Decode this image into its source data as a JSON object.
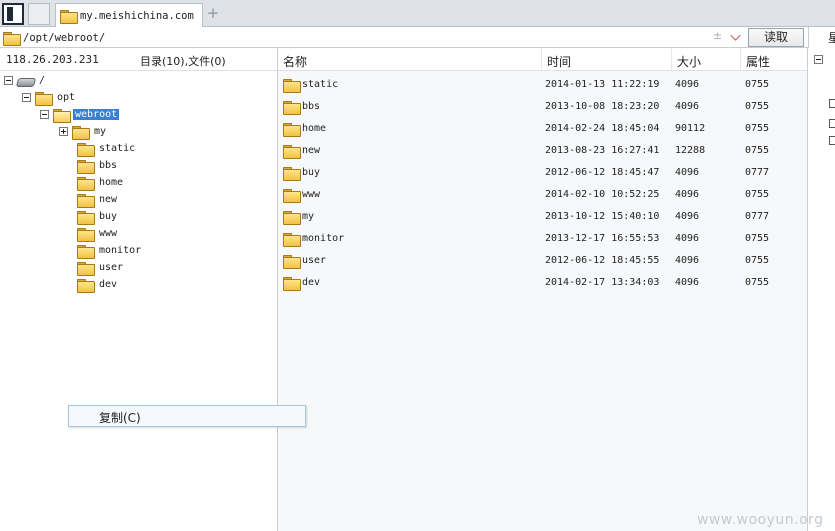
{
  "tabbar": {
    "active_tab_label": "my.meishichina.com",
    "new_tab_label": "+"
  },
  "address": {
    "path": "/opt/webroot/",
    "extra_plus": "±",
    "read_label": "读取",
    "right_label": "星"
  },
  "left": {
    "ip": "118.26.203.231",
    "summary": "目录(10),文件(0)",
    "tree": [
      {
        "label": "/",
        "kind": "drive",
        "expander": "minus",
        "depth": 0
      },
      {
        "label": "opt",
        "kind": "folder",
        "expander": "minus",
        "depth": 1
      },
      {
        "label": "webroot",
        "kind": "folder-open",
        "expander": "minus",
        "depth": 2,
        "selected": true
      },
      {
        "label": "my",
        "kind": "folder",
        "expander": "plus",
        "depth": 3
      },
      {
        "label": "static",
        "kind": "folder",
        "expander": "",
        "depth": 3
      },
      {
        "label": "bbs",
        "kind": "folder",
        "expander": "",
        "depth": 3
      },
      {
        "label": "home",
        "kind": "folder",
        "expander": "",
        "depth": 3
      },
      {
        "label": "new",
        "kind": "folder",
        "expander": "",
        "depth": 3
      },
      {
        "label": "buy",
        "kind": "folder",
        "expander": "",
        "depth": 3
      },
      {
        "label": "www",
        "kind": "folder",
        "expander": "",
        "depth": 3
      },
      {
        "label": "monitor",
        "kind": "folder",
        "expander": "",
        "depth": 3
      },
      {
        "label": "user",
        "kind": "folder",
        "expander": "",
        "depth": 3
      },
      {
        "label": "dev",
        "kind": "folder",
        "expander": "",
        "depth": 3
      }
    ]
  },
  "context_menu": {
    "item_label": "复制(C)"
  },
  "files": {
    "columns": [
      "名称",
      "时间",
      "大小",
      "属性"
    ],
    "rows": [
      {
        "name": "static",
        "time": "2014-01-13 11:22:19",
        "size": "4096",
        "attr": "0755"
      },
      {
        "name": "bbs",
        "time": "2013-10-08 18:23:20",
        "size": "4096",
        "attr": "0755"
      },
      {
        "name": "home",
        "time": "2014-02-24 18:45:04",
        "size": "90112",
        "attr": "0755"
      },
      {
        "name": "new",
        "time": "2013-08-23 16:27:41",
        "size": "12288",
        "attr": "0755"
      },
      {
        "name": "buy",
        "time": "2012-06-12 18:45:47",
        "size": "4096",
        "attr": "0777"
      },
      {
        "name": "www",
        "time": "2014-02-10 10:52:25",
        "size": "4096",
        "attr": "0755"
      },
      {
        "name": "my",
        "time": "2013-10-12 15:40:10",
        "size": "4096",
        "attr": "0777"
      },
      {
        "name": "monitor",
        "time": "2013-12-17 16:55:53",
        "size": "4096",
        "attr": "0755"
      },
      {
        "name": "user",
        "time": "2012-06-12 18:45:55",
        "size": "4096",
        "attr": "0755"
      },
      {
        "name": "dev",
        "time": "2014-02-17 13:34:03",
        "size": "4096",
        "attr": "0755"
      }
    ]
  },
  "watermark": "www.wooyun.org",
  "colors": {
    "selection": "#3b7fd1",
    "folder": "#f1c244",
    "menu_border": "#a9c3e2"
  }
}
